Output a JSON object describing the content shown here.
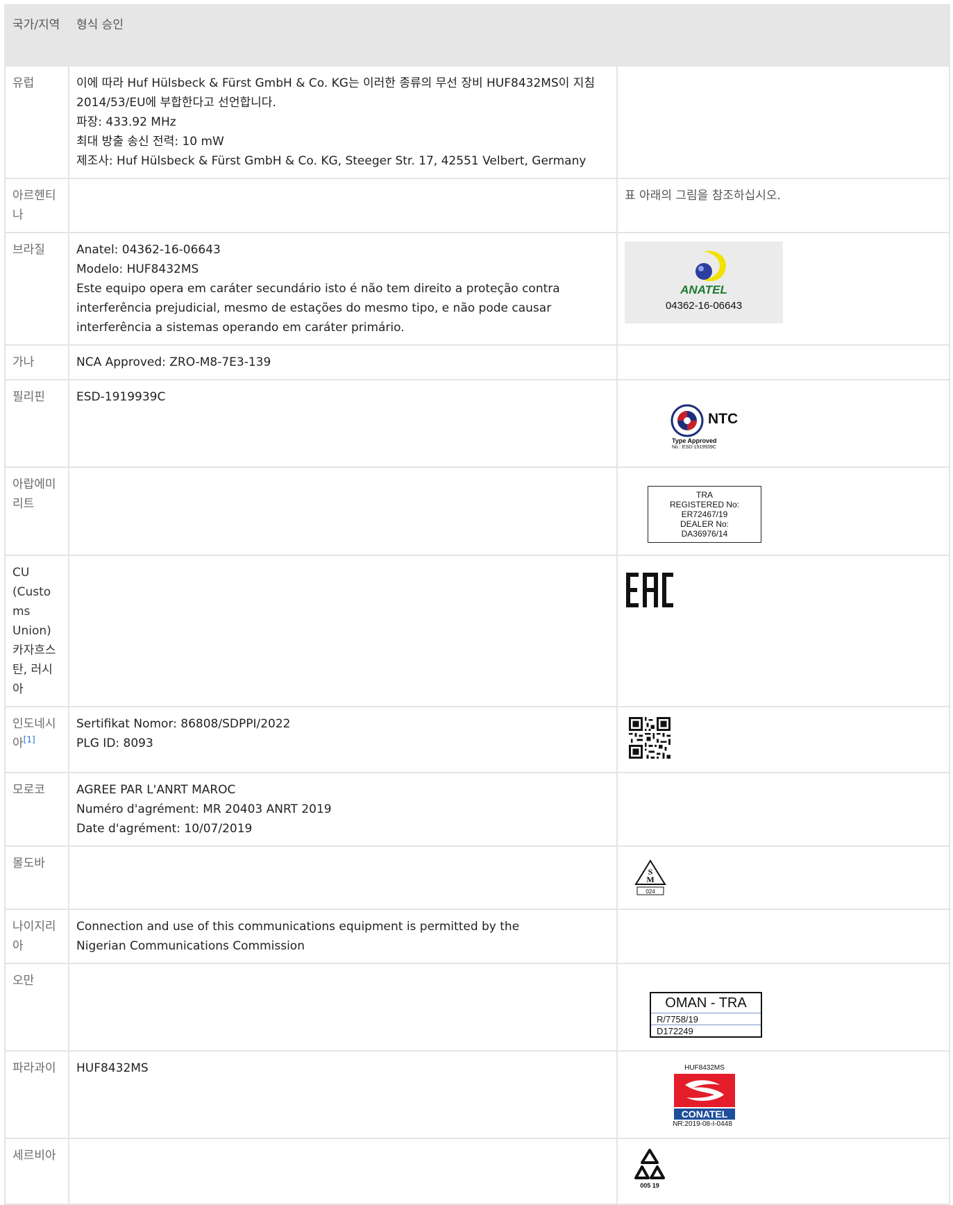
{
  "table": {
    "headers": {
      "country": "국가/지역",
      "approval": "형식 승인"
    },
    "rows": {
      "eu": {
        "country": "유럽",
        "lines": [
          "이에 따라 Huf Hülsbeck & Fürst GmbH & Co. KG는 이러한 종류의 무선 장비 HUF8432MS이 지침 2014/53/EU에 부합한다고 선언합니다.",
          "파장: 433.92 MHz",
          "최대 방출 송신 전력: 10 mW",
          "제조사: Huf Hülsbeck & Fürst GmbH & Co. KG, Steeger Str. 17, 42551 Velbert, Germany"
        ]
      },
      "argentina": {
        "country": "아르헨티나",
        "note": "표 아래의 그림을 참조하십시오."
      },
      "brazil": {
        "country": "브라질",
        "lines": [
          "Anatel: 04362-16-06643",
          "Modelo: HUF8432MS",
          "Este equipo opera em caráter secundário isto é não tem direito a proteção contra interferência prejudicial, mesmo de estações do mesmo tipo, e não pode causar interferência a sistemas operando em caráter primário."
        ],
        "logo": {
          "word": "ANATEL",
          "number": "04362-16-06643"
        }
      },
      "ghana": {
        "country": "가나",
        "text": "NCA Approved: ZRO-M8-7E3-139"
      },
      "philippines": {
        "country": "필리핀",
        "text": "ESD-1919939C",
        "logo": {
          "word": "NTC",
          "type_approved": "Type Approved",
          "number": "No.: ESD-1919939C"
        }
      },
      "uae": {
        "country": "아랍에미리트",
        "label": {
          "lines": [
            "TRA",
            "REGISTERED No:",
            "ER72467/19",
            "DEALER No:",
            "DA36976/14"
          ]
        }
      },
      "cu": {
        "country": "CU (Customs Union) 카자흐스탄, 러시아",
        "logo_text": "EAC"
      },
      "indonesia": {
        "country": "인도네시아",
        "ref": "[1]",
        "lines": [
          "Sertifikat Nomor: 86808/SDPPI/2022",
          "PLG ID: 8093"
        ]
      },
      "morocco": {
        "country": "모로코",
        "lines": [
          "AGREE PAR L'ANRT MAROC",
          "Numéro d'agrément: MR 20403 ANRT 2019",
          "Date d'agrément: 10/07/2019"
        ]
      },
      "moldova": {
        "country": "몰도바",
        "logo_number": "024"
      },
      "nigeria": {
        "country": "나이지리아",
        "text": "Connection and use of this communications equipment is permitted by the Nigerian Communications Commission"
      },
      "oman": {
        "country": "오만",
        "label": {
          "title": "OMAN - TRA",
          "r": "R/7758/19",
          "d": "D172249"
        }
      },
      "paraguay": {
        "country": "파라과이",
        "text": "HUF8432MS",
        "logo": {
          "top": "HUF8432MS",
          "word": "CONATEL",
          "number": "NR:2019-08-I-0448"
        }
      },
      "serbia": {
        "country": "세르비아",
        "logo_number": "005 19"
      }
    }
  },
  "colors": {
    "header_bg": "#e6e6e6",
    "border": "#e4e4e4",
    "anatel_green": "#1a7a2f",
    "anatel_yellow": "#f2e200",
    "conatel_red": "#e31e2a",
    "conatel_blue": "#1f4f9c",
    "link": "#1a73c8"
  }
}
